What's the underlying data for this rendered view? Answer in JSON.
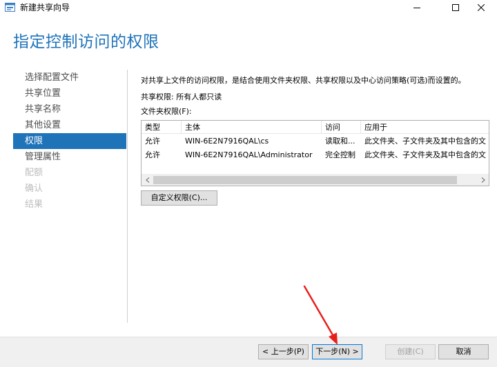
{
  "window": {
    "title": "新建共享向导"
  },
  "header": {
    "title": "指定控制访问的权限"
  },
  "nav": {
    "items": [
      {
        "label": "选择配置文件"
      },
      {
        "label": "共享位置"
      },
      {
        "label": "共享名称"
      },
      {
        "label": "其他设置"
      },
      {
        "label": "权限"
      },
      {
        "label": "管理属性"
      },
      {
        "label": "配额"
      },
      {
        "label": "确认"
      },
      {
        "label": "结果"
      }
    ]
  },
  "content": {
    "description": "对共享上文件的访问权限，是结合使用文件夹权限、共享权限以及中心访问策略(可选)而设置的。",
    "share_permissions": "共享权限: 所有人都只读",
    "folder_permissions_label": "文件夹权限(F):",
    "table": {
      "columns": [
        "类型",
        "主体",
        "访问",
        "应用于"
      ],
      "rows": [
        [
          "允许",
          "WIN-6E2N7916QAL\\cs",
          "读取和...",
          "此文件夹、子文件夹及其中包含的文"
        ],
        [
          "允许",
          "WIN-6E2N7916QAL\\Administrator",
          "完全控制",
          "此文件夹、子文件夹及其中包含的文"
        ]
      ]
    },
    "custom_button": "自定义权限(C)..."
  },
  "footer": {
    "prev": "< 上一步(P)",
    "next": "下一步(N) >",
    "create": "创建(C)",
    "cancel": "取消"
  },
  "colors": {
    "accent": "#1e73b9",
    "annotation_arrow": "#e8201a"
  }
}
